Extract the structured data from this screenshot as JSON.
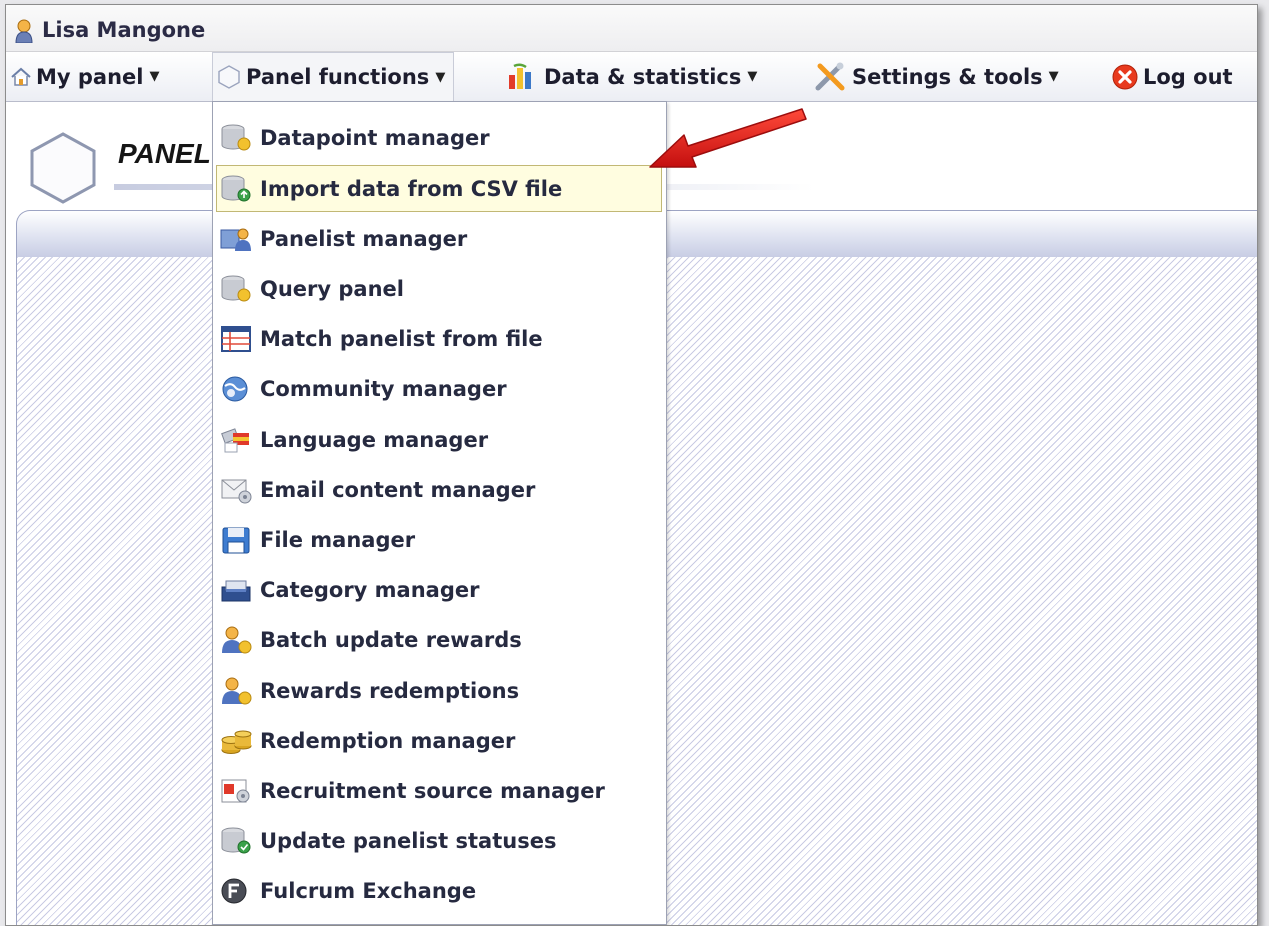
{
  "user": {
    "name": "Lisa Mangone"
  },
  "nav": {
    "my_panel": "My panel",
    "panel_functions": "Panel functions",
    "data_statistics": "Data & statistics",
    "settings_tools": "Settings & tools",
    "log_out": "Log out",
    "caret": "▼"
  },
  "page": {
    "title": "PANEL"
  },
  "menu": {
    "selected_index": 1,
    "items": [
      {
        "label": "Datapoint manager",
        "icon": "database-icon"
      },
      {
        "label": "Import data from CSV file",
        "icon": "database-import-icon"
      },
      {
        "label": "Panelist manager",
        "icon": "panelist-icon"
      },
      {
        "label": "Query panel",
        "icon": "database-query-icon"
      },
      {
        "label": "Match panelist from file",
        "icon": "table-file-icon"
      },
      {
        "label": "Community manager",
        "icon": "community-icon"
      },
      {
        "label": "Language manager",
        "icon": "language-icon"
      },
      {
        "label": "Email content manager",
        "icon": "email-icon"
      },
      {
        "label": "File manager",
        "icon": "floppy-disk-icon"
      },
      {
        "label": "Category manager",
        "icon": "category-icon"
      },
      {
        "label": "Batch update rewards",
        "icon": "rewards-user-icon"
      },
      {
        "label": "Rewards redemptions",
        "icon": "rewards-user-icon"
      },
      {
        "label": "Redemption manager",
        "icon": "coins-icon"
      },
      {
        "label": "Recruitment source manager",
        "icon": "recruitment-icon"
      },
      {
        "label": "Update panelist statuses",
        "icon": "database-update-icon"
      },
      {
        "label": "Fulcrum Exchange",
        "icon": "fulcrum-icon"
      }
    ]
  },
  "colors": {
    "accent_arrow": "#e31b1b",
    "highlight": "#fffde0",
    "menu_border": "#9da2b4"
  }
}
